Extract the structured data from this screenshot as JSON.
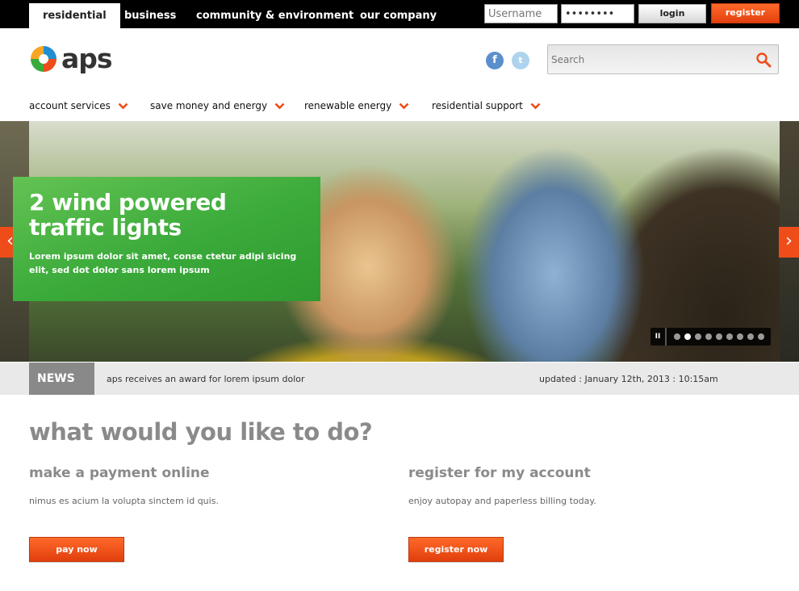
{
  "top_tabs": [
    {
      "label": "residential",
      "active": true
    },
    {
      "label": "business",
      "active": false
    },
    {
      "label": "community & environment",
      "active": false
    },
    {
      "label": "our company",
      "active": false
    }
  ],
  "login": {
    "username_placeholder": "Username",
    "password_value": "••••••••",
    "login_label": "login",
    "register_label": "register"
  },
  "brand": {
    "logo_text": "aps",
    "accent": "#ee4d1a",
    "green": "#3aaa3a"
  },
  "social": {
    "facebook_glyph": "f",
    "twitter_glyph": "t",
    "facebook_icon": "facebook-icon",
    "twitter_icon": "twitter-icon"
  },
  "search": {
    "placeholder": "Search",
    "icon": "search-icon"
  },
  "nav": [
    {
      "label": "account services"
    },
    {
      "label": "save money and energy"
    },
    {
      "label": "renewable energy"
    },
    {
      "label": "residential support"
    }
  ],
  "hero": {
    "title": "2 wind powered traffic lights",
    "text": "Lorem ipsum dolor sit amet, conse ctetur adipi sicing elit, sed dot dolor sans lorem ipsum",
    "prev_glyph": "‹",
    "next_glyph": "›",
    "pause_glyph": "II",
    "slide_count": 9,
    "active_slide": 2
  },
  "news": {
    "label": "NEWS",
    "headline": "aps receives an award for lorem ipsum dolor",
    "updated": "updated : January 12th, 2013 : 10:15am"
  },
  "main": {
    "title": "what would you like to do?",
    "columns": [
      {
        "title": "make a payment online",
        "text": "nimus es acium la volupta sinctem id quis.",
        "button": "pay now"
      },
      {
        "title": "register for my account",
        "text": "enjoy autopay and paperless billing today.",
        "button": "register now"
      }
    ]
  }
}
